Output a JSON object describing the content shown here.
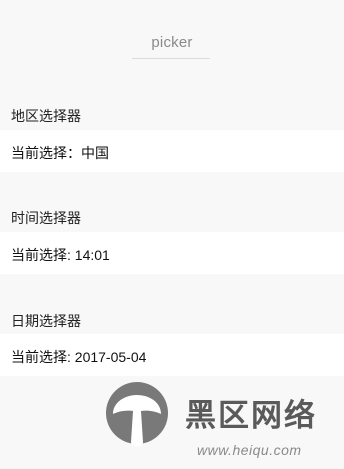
{
  "header": {
    "title": "picker"
  },
  "sections": [
    {
      "title": "地区选择器",
      "value_text": "当前选择：中国"
    },
    {
      "title": "时间选择器",
      "value_text": "当前选择: 14:01"
    },
    {
      "title": "日期选择器",
      "value_text": "当前选择: 2017-05-04"
    }
  ],
  "watermark": {
    "title": "黑区网络",
    "url": "www.heiqu.com"
  },
  "colors": {
    "page_background": "#f8f8f8",
    "row_background": "#ffffff",
    "title_text": "#8a8a8a",
    "watermark_gray": "#5a5a5a"
  }
}
